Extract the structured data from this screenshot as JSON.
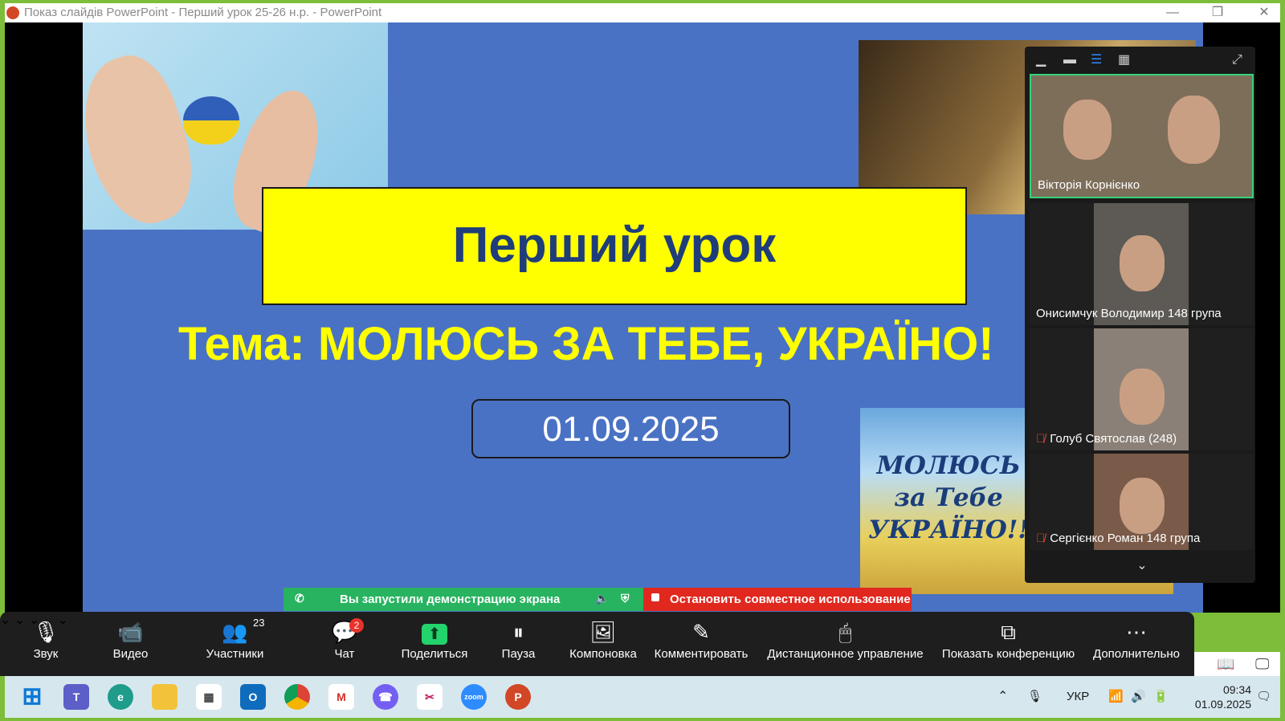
{
  "window": {
    "title": "Показ слайдів PowerPoint  -  Перший урок 25-26 н.р. - PowerPoint",
    "minimize": "—",
    "restore": "❐",
    "close": "✕"
  },
  "slide": {
    "title": "Перший урок",
    "theme": "Тема: МОЛЮСЬ ЗА ТЕБЕ, УКРАЇНО!",
    "date": "01.09.2025",
    "poster_text": "МОЛЮСЬ за Тебе УКРАЇНО!!!"
  },
  "video_panel": {
    "participants": [
      {
        "name": "Вікторія Корнієнко",
        "muted": false
      },
      {
        "name": "Онисимчук Володимир 148 група",
        "muted": false
      },
      {
        "name": "Голуб Святослав (248)",
        "muted": true
      },
      {
        "name": "Сергієнко Роман 148 група",
        "muted": true
      }
    ]
  },
  "share_banner": {
    "status": "Вы запустили демонстрацию экрана",
    "stop": "Остановить совместное использование"
  },
  "toolbar": {
    "audio": "Звук",
    "video": "Видео",
    "participants": "Участники",
    "participants_count": "23",
    "chat": "Чат",
    "chat_badge": "2",
    "share": "Поделиться",
    "pause": "Пауза",
    "layout": "Компоновка",
    "annotate": "Комментировать",
    "remote": "Дистанционное управление",
    "show_meeting": "Показать конференцию",
    "more": "Дополнительно"
  },
  "taskbar": {
    "language": "УКР",
    "time": "09:34",
    "date": "01.09.2025",
    "zoom_label": "zoom"
  },
  "colors": {
    "slide_bg": "#4a72c4",
    "yellow": "#ffff00",
    "active_speaker": "#35d27a",
    "share_green": "#27b35f",
    "stop_red": "#e0281f"
  }
}
